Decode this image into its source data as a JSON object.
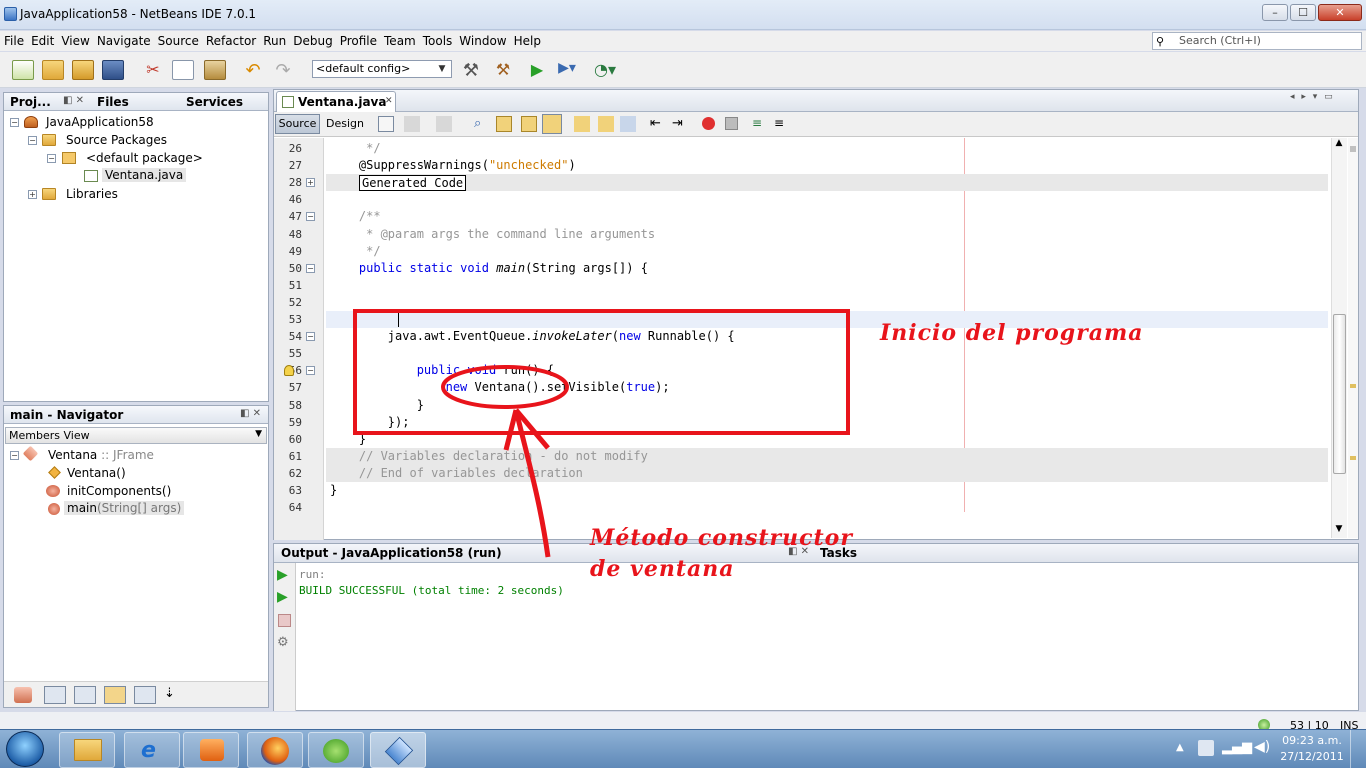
{
  "window": {
    "title": "JavaApplication58 - NetBeans IDE 7.0.1",
    "buttons": [
      "–",
      "☐",
      "✕"
    ]
  },
  "menu": [
    "File",
    "Edit",
    "View",
    "Navigate",
    "Source",
    "Refactor",
    "Run",
    "Debug",
    "Profile",
    "Team",
    "Tools",
    "Window",
    "Help"
  ],
  "search": {
    "placeholder": "Search (Ctrl+I)"
  },
  "toolbar": {
    "config": "<default config>"
  },
  "projects": {
    "tabs": [
      "Proj...",
      "Files",
      "Services"
    ],
    "tree": [
      {
        "label": "JavaApplication58"
      },
      {
        "label": "Source Packages"
      },
      {
        "label": "<default package>"
      },
      {
        "label": "Ventana.java"
      },
      {
        "label": "Libraries"
      }
    ]
  },
  "navigator": {
    "title": "main - Navigator",
    "view": "Members View",
    "items": [
      {
        "label": "Ventana",
        "suffix": " :: JFrame"
      },
      {
        "label": "Ventana()"
      },
      {
        "label": "initComponents()"
      },
      {
        "label": "main",
        "suffix": "(String[] args)"
      }
    ]
  },
  "editor": {
    "tab": "Ventana.java",
    "modes": [
      "Source",
      "Design"
    ],
    "lines": [
      {
        "n": "26",
        "text": "     */"
      },
      {
        "n": "27",
        "text": "    @SuppressWarnings(\"unchecked\")"
      },
      {
        "n": "28",
        "text": "Generated Code"
      },
      {
        "n": "46",
        "text": ""
      },
      {
        "n": "47",
        "text": "    /**"
      },
      {
        "n": "48",
        "text": "     * @param args the command line arguments"
      },
      {
        "n": "49",
        "text": "     */"
      },
      {
        "n": "50",
        "text": "    public static void main(String args[]) {"
      },
      {
        "n": "51",
        "text": ""
      },
      {
        "n": "52",
        "text": ""
      },
      {
        "n": "53",
        "text": ""
      },
      {
        "n": "54",
        "text": "        java.awt.EventQueue.invokeLater(new Runnable() {"
      },
      {
        "n": "55",
        "text": ""
      },
      {
        "n": "56",
        "text": "            public void run() {"
      },
      {
        "n": "57",
        "text": "                new Ventana().setVisible(true);"
      },
      {
        "n": "58",
        "text": "            }"
      },
      {
        "n": "59",
        "text": "        });"
      },
      {
        "n": "60",
        "text": "    }"
      },
      {
        "n": "61",
        "text": "    // Variables declaration - do not modify"
      },
      {
        "n": "62",
        "text": "    // End of variables declaration"
      },
      {
        "n": "63",
        "text": "}"
      },
      {
        "n": "64",
        "text": ""
      }
    ]
  },
  "output": {
    "title": "Output - JavaApplication58 (run)",
    "tasks": "Tasks",
    "lines": [
      "run:",
      "BUILD SUCCESSFUL (total time: 2 seconds)"
    ]
  },
  "status": {
    "position": "53 | 10",
    "mode": "INS"
  },
  "annotations": {
    "inicio": "Inicio del programa",
    "metodo_1": "Método constructor",
    "metodo_2": "de ventana"
  },
  "clock": {
    "time": "09:23 a.m.",
    "date": "27/12/2011"
  },
  "colors": {
    "annotation": "#e8141b",
    "keyword": "#0000e6",
    "comment": "#969696",
    "string": "#ce7b00"
  }
}
